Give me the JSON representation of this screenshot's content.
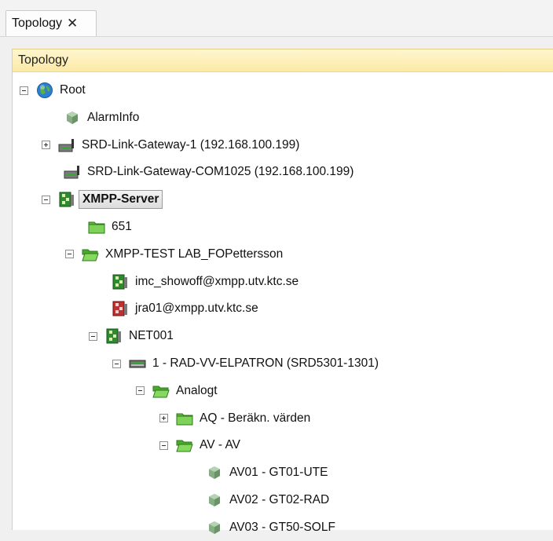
{
  "tab": {
    "label": "Topology",
    "close_glyph": "✕"
  },
  "panel": {
    "title": "Topology"
  },
  "tree": [
    {
      "label": "Root",
      "icon": "globe-icon",
      "expander": "minus"
    },
    {
      "label": "AlarmInfo",
      "icon": "cube-icon",
      "expander": "none"
    },
    {
      "label": "SRD-Link-Gateway-1 (192.168.100.199)",
      "icon": "gateway-icon",
      "expander": "plus"
    },
    {
      "label": "SRD-Link-Gateway-COM1025 (192.168.100.199)",
      "icon": "gateway-icon",
      "expander": "none"
    },
    {
      "label": "XMPP-Server",
      "icon": "xmpp-server-icon",
      "expander": "minus",
      "selected": true
    },
    {
      "label": "651",
      "icon": "folder-icon",
      "expander": "none"
    },
    {
      "label": "XMPP-TEST LAB_FOPettersson",
      "icon": "folder-open-icon",
      "expander": "minus"
    },
    {
      "label": "imc_showoff@xmpp.utv.ktc.se",
      "icon": "xmpp-contact-icon",
      "expander": "none"
    },
    {
      "label": "jra01@xmpp.utv.ktc.se",
      "icon": "xmpp-contact-offline-icon",
      "expander": "none"
    },
    {
      "label": "NET001",
      "icon": "xmpp-contact-icon",
      "expander": "minus"
    },
    {
      "label": "1 - RAD-VV-ELPATRON (SRD5301-1301)",
      "icon": "device-icon",
      "expander": "minus"
    },
    {
      "label": "Analogt",
      "icon": "folder-open-icon",
      "expander": "minus"
    },
    {
      "label": "AQ - Beräkn. värden",
      "icon": "folder-icon",
      "expander": "plus"
    },
    {
      "label": "AV - AV",
      "icon": "folder-open-icon",
      "expander": "minus"
    },
    {
      "label": "AV01 - GT01-UTE",
      "icon": "cube-icon",
      "expander": "none"
    },
    {
      "label": "AV02 - GT02-RAD",
      "icon": "cube-icon",
      "expander": "none"
    },
    {
      "label": "AV03 - GT50-SOLF",
      "icon": "cube-icon",
      "expander": "none"
    }
  ],
  "colors": {
    "panel_border": "#e2cf8a",
    "header_bg": "#fbe9a6",
    "folder": "#5fbf3c",
    "cube": "#7fa87a"
  }
}
